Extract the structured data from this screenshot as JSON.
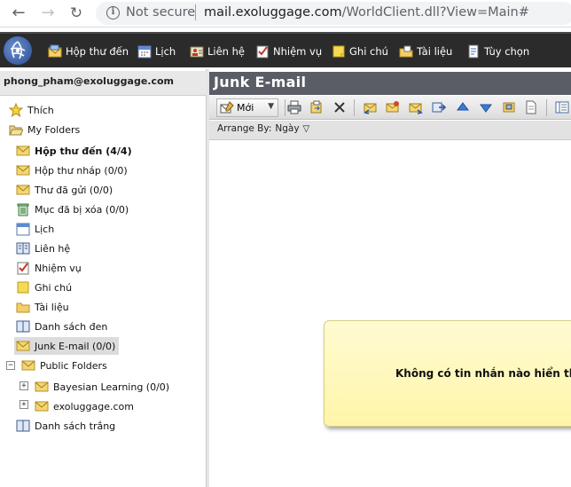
{
  "browser": {
    "security_label": "Not secure",
    "url_host": "mail.exoluggage.com",
    "url_path": "/WorldClient.dll?View=Main#"
  },
  "nav": {
    "inbox": "Hộp thư đến",
    "calendar": "Lịch",
    "contacts": "Liên hệ",
    "tasks": "Nhiệm vụ",
    "notes": "Ghi chú",
    "documents": "Tài liệu",
    "options": "Tùy chọn"
  },
  "account": "phong_pham@exoluggage.com",
  "folders": {
    "favorites": "Thích",
    "my_folders": "My Folders",
    "inbox": "Hộp thư đến (4/4)",
    "drafts": "Hộp thư nháp (0/0)",
    "sent": "Thư đã gửi (0/0)",
    "deleted": "Mục đã bị xóa (0/0)",
    "calendar": "Lịch",
    "contacts": "Liên hệ",
    "tasks": "Nhiệm vụ",
    "notes": "Ghi chú",
    "documents": "Tài liệu",
    "blacklist": "Danh sách đen",
    "junk": "Junk E-mail (0/0)",
    "public_folders": "Public Folders",
    "bayesian": "Bayesian Learning (0/0)",
    "domain": "exoluggage.com",
    "whitelist": "Danh sách trắng"
  },
  "main": {
    "title": "Junk E-mail",
    "new_label": "Mới",
    "sort_label": "Arrange By:",
    "sort_value": "Ngày",
    "empty_message": "Không có tin nhắn nào hiển thị."
  },
  "colors": {
    "app_bar": "#2b2b2b",
    "title_bar": "#5a5d66",
    "empty_box": "#fff5a9",
    "selected_folder": "#dcdcdc"
  }
}
